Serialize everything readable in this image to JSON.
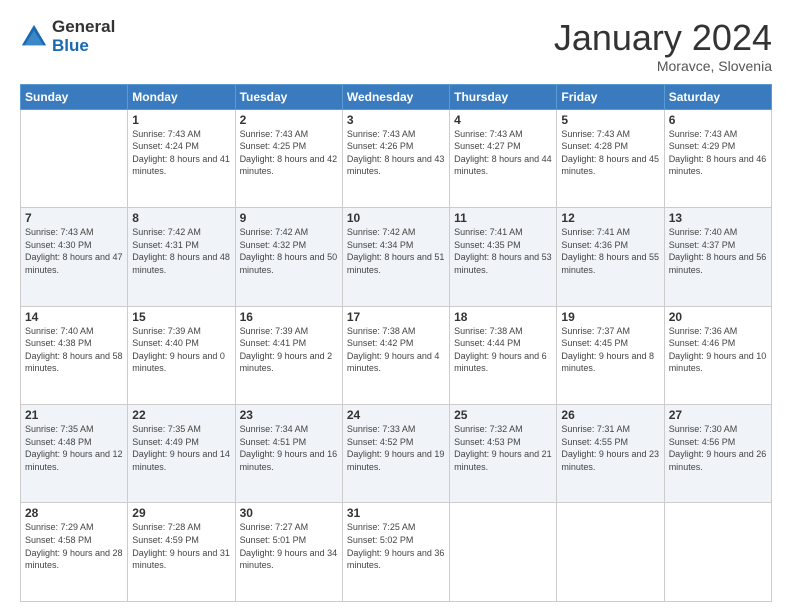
{
  "logo": {
    "general": "General",
    "blue": "Blue"
  },
  "header": {
    "month": "January 2024",
    "location": "Moravce, Slovenia"
  },
  "weekdays": [
    "Sunday",
    "Monday",
    "Tuesday",
    "Wednesday",
    "Thursday",
    "Friday",
    "Saturday"
  ],
  "weeks": [
    [
      {
        "day": "",
        "sunrise": "",
        "sunset": "",
        "daylight": ""
      },
      {
        "day": "1",
        "sunrise": "Sunrise: 7:43 AM",
        "sunset": "Sunset: 4:24 PM",
        "daylight": "Daylight: 8 hours and 41 minutes."
      },
      {
        "day": "2",
        "sunrise": "Sunrise: 7:43 AM",
        "sunset": "Sunset: 4:25 PM",
        "daylight": "Daylight: 8 hours and 42 minutes."
      },
      {
        "day": "3",
        "sunrise": "Sunrise: 7:43 AM",
        "sunset": "Sunset: 4:26 PM",
        "daylight": "Daylight: 8 hours and 43 minutes."
      },
      {
        "day": "4",
        "sunrise": "Sunrise: 7:43 AM",
        "sunset": "Sunset: 4:27 PM",
        "daylight": "Daylight: 8 hours and 44 minutes."
      },
      {
        "day": "5",
        "sunrise": "Sunrise: 7:43 AM",
        "sunset": "Sunset: 4:28 PM",
        "daylight": "Daylight: 8 hours and 45 minutes."
      },
      {
        "day": "6",
        "sunrise": "Sunrise: 7:43 AM",
        "sunset": "Sunset: 4:29 PM",
        "daylight": "Daylight: 8 hours and 46 minutes."
      }
    ],
    [
      {
        "day": "7",
        "sunrise": "Sunrise: 7:43 AM",
        "sunset": "Sunset: 4:30 PM",
        "daylight": "Daylight: 8 hours and 47 minutes."
      },
      {
        "day": "8",
        "sunrise": "Sunrise: 7:42 AM",
        "sunset": "Sunset: 4:31 PM",
        "daylight": "Daylight: 8 hours and 48 minutes."
      },
      {
        "day": "9",
        "sunrise": "Sunrise: 7:42 AM",
        "sunset": "Sunset: 4:32 PM",
        "daylight": "Daylight: 8 hours and 50 minutes."
      },
      {
        "day": "10",
        "sunrise": "Sunrise: 7:42 AM",
        "sunset": "Sunset: 4:34 PM",
        "daylight": "Daylight: 8 hours and 51 minutes."
      },
      {
        "day": "11",
        "sunrise": "Sunrise: 7:41 AM",
        "sunset": "Sunset: 4:35 PM",
        "daylight": "Daylight: 8 hours and 53 minutes."
      },
      {
        "day": "12",
        "sunrise": "Sunrise: 7:41 AM",
        "sunset": "Sunset: 4:36 PM",
        "daylight": "Daylight: 8 hours and 55 minutes."
      },
      {
        "day": "13",
        "sunrise": "Sunrise: 7:40 AM",
        "sunset": "Sunset: 4:37 PM",
        "daylight": "Daylight: 8 hours and 56 minutes."
      }
    ],
    [
      {
        "day": "14",
        "sunrise": "Sunrise: 7:40 AM",
        "sunset": "Sunset: 4:38 PM",
        "daylight": "Daylight: 8 hours and 58 minutes."
      },
      {
        "day": "15",
        "sunrise": "Sunrise: 7:39 AM",
        "sunset": "Sunset: 4:40 PM",
        "daylight": "Daylight: 9 hours and 0 minutes."
      },
      {
        "day": "16",
        "sunrise": "Sunrise: 7:39 AM",
        "sunset": "Sunset: 4:41 PM",
        "daylight": "Daylight: 9 hours and 2 minutes."
      },
      {
        "day": "17",
        "sunrise": "Sunrise: 7:38 AM",
        "sunset": "Sunset: 4:42 PM",
        "daylight": "Daylight: 9 hours and 4 minutes."
      },
      {
        "day": "18",
        "sunrise": "Sunrise: 7:38 AM",
        "sunset": "Sunset: 4:44 PM",
        "daylight": "Daylight: 9 hours and 6 minutes."
      },
      {
        "day": "19",
        "sunrise": "Sunrise: 7:37 AM",
        "sunset": "Sunset: 4:45 PM",
        "daylight": "Daylight: 9 hours and 8 minutes."
      },
      {
        "day": "20",
        "sunrise": "Sunrise: 7:36 AM",
        "sunset": "Sunset: 4:46 PM",
        "daylight": "Daylight: 9 hours and 10 minutes."
      }
    ],
    [
      {
        "day": "21",
        "sunrise": "Sunrise: 7:35 AM",
        "sunset": "Sunset: 4:48 PM",
        "daylight": "Daylight: 9 hours and 12 minutes."
      },
      {
        "day": "22",
        "sunrise": "Sunrise: 7:35 AM",
        "sunset": "Sunset: 4:49 PM",
        "daylight": "Daylight: 9 hours and 14 minutes."
      },
      {
        "day": "23",
        "sunrise": "Sunrise: 7:34 AM",
        "sunset": "Sunset: 4:51 PM",
        "daylight": "Daylight: 9 hours and 16 minutes."
      },
      {
        "day": "24",
        "sunrise": "Sunrise: 7:33 AM",
        "sunset": "Sunset: 4:52 PM",
        "daylight": "Daylight: 9 hours and 19 minutes."
      },
      {
        "day": "25",
        "sunrise": "Sunrise: 7:32 AM",
        "sunset": "Sunset: 4:53 PM",
        "daylight": "Daylight: 9 hours and 21 minutes."
      },
      {
        "day": "26",
        "sunrise": "Sunrise: 7:31 AM",
        "sunset": "Sunset: 4:55 PM",
        "daylight": "Daylight: 9 hours and 23 minutes."
      },
      {
        "day": "27",
        "sunrise": "Sunrise: 7:30 AM",
        "sunset": "Sunset: 4:56 PM",
        "daylight": "Daylight: 9 hours and 26 minutes."
      }
    ],
    [
      {
        "day": "28",
        "sunrise": "Sunrise: 7:29 AM",
        "sunset": "Sunset: 4:58 PM",
        "daylight": "Daylight: 9 hours and 28 minutes."
      },
      {
        "day": "29",
        "sunrise": "Sunrise: 7:28 AM",
        "sunset": "Sunset: 4:59 PM",
        "daylight": "Daylight: 9 hours and 31 minutes."
      },
      {
        "day": "30",
        "sunrise": "Sunrise: 7:27 AM",
        "sunset": "Sunset: 5:01 PM",
        "daylight": "Daylight: 9 hours and 34 minutes."
      },
      {
        "day": "31",
        "sunrise": "Sunrise: 7:25 AM",
        "sunset": "Sunset: 5:02 PM",
        "daylight": "Daylight: 9 hours and 36 minutes."
      },
      {
        "day": "",
        "sunrise": "",
        "sunset": "",
        "daylight": ""
      },
      {
        "day": "",
        "sunrise": "",
        "sunset": "",
        "daylight": ""
      },
      {
        "day": "",
        "sunrise": "",
        "sunset": "",
        "daylight": ""
      }
    ]
  ]
}
